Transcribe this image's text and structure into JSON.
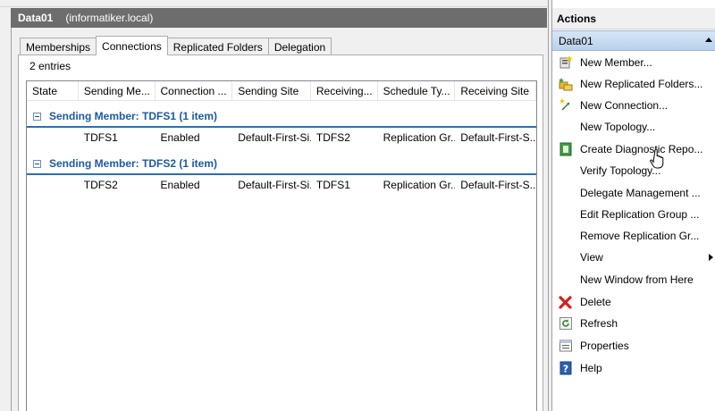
{
  "left": {
    "title": "Data01",
    "subtitle": "(informatiker.local)",
    "tabs": [
      {
        "label": "Memberships"
      },
      {
        "label": "Connections"
      },
      {
        "label": "Replicated Folders"
      },
      {
        "label": "Delegation"
      }
    ],
    "active_tab": "Connections",
    "entries": "2 entries",
    "columns": [
      {
        "label": "State"
      },
      {
        "label": "Sending Me..."
      },
      {
        "label": "Connection ..."
      },
      {
        "label": "Sending Site"
      },
      {
        "label": "Receiving..."
      },
      {
        "label": "Schedule Ty..."
      },
      {
        "label": "Receiving Site"
      }
    ],
    "groups": [
      {
        "title": "Sending Member: TDFS1 (1 item)",
        "rows": [
          {
            "state": "",
            "sending_member": "TDFS1",
            "connection": "Enabled",
            "sending_site": "Default-First-Si...",
            "receiving": "TDFS2",
            "schedule": "Replication Gr...",
            "receiving_site": "Default-First-S..."
          }
        ]
      },
      {
        "title": "Sending Member: TDFS2 (1 item)",
        "rows": [
          {
            "state": "",
            "sending_member": "TDFS2",
            "connection": "Enabled",
            "sending_site": "Default-First-Si...",
            "receiving": "TDFS1",
            "schedule": "Replication Gr...",
            "receiving_site": "Default-First-S..."
          }
        ]
      }
    ]
  },
  "actions": {
    "header": "Actions",
    "section": "Data01",
    "items": [
      {
        "label": "New Member...",
        "icon": "new-member-icon"
      },
      {
        "label": "New Replicated Folders...",
        "icon": "new-replicated-folders-icon"
      },
      {
        "label": "New Connection...",
        "icon": "new-connection-icon"
      },
      {
        "label": "New Topology...",
        "icon": ""
      },
      {
        "label": "Create Diagnostic Repo...",
        "icon": "diagnostic-report-icon"
      },
      {
        "label": "Verify Topology...",
        "icon": ""
      },
      {
        "label": "Delegate Management ...",
        "icon": ""
      },
      {
        "label": "Edit Replication Group ...",
        "icon": ""
      },
      {
        "label": "Remove Replication Gr...",
        "icon": ""
      },
      {
        "label": "View",
        "icon": "",
        "submenu": true
      },
      {
        "label": "New Window from Here",
        "icon": ""
      },
      {
        "label": "Delete",
        "icon": "delete-icon"
      },
      {
        "label": "Refresh",
        "icon": "refresh-icon"
      },
      {
        "label": "Properties",
        "icon": "properties-icon"
      },
      {
        "label": "Help",
        "icon": "help-icon"
      }
    ]
  },
  "colors": {
    "header_bg": "#6d6d6d",
    "group_title": "#1e5aa0",
    "group_line": "#2c6fb0",
    "section_bg": "#c6dbf2"
  }
}
